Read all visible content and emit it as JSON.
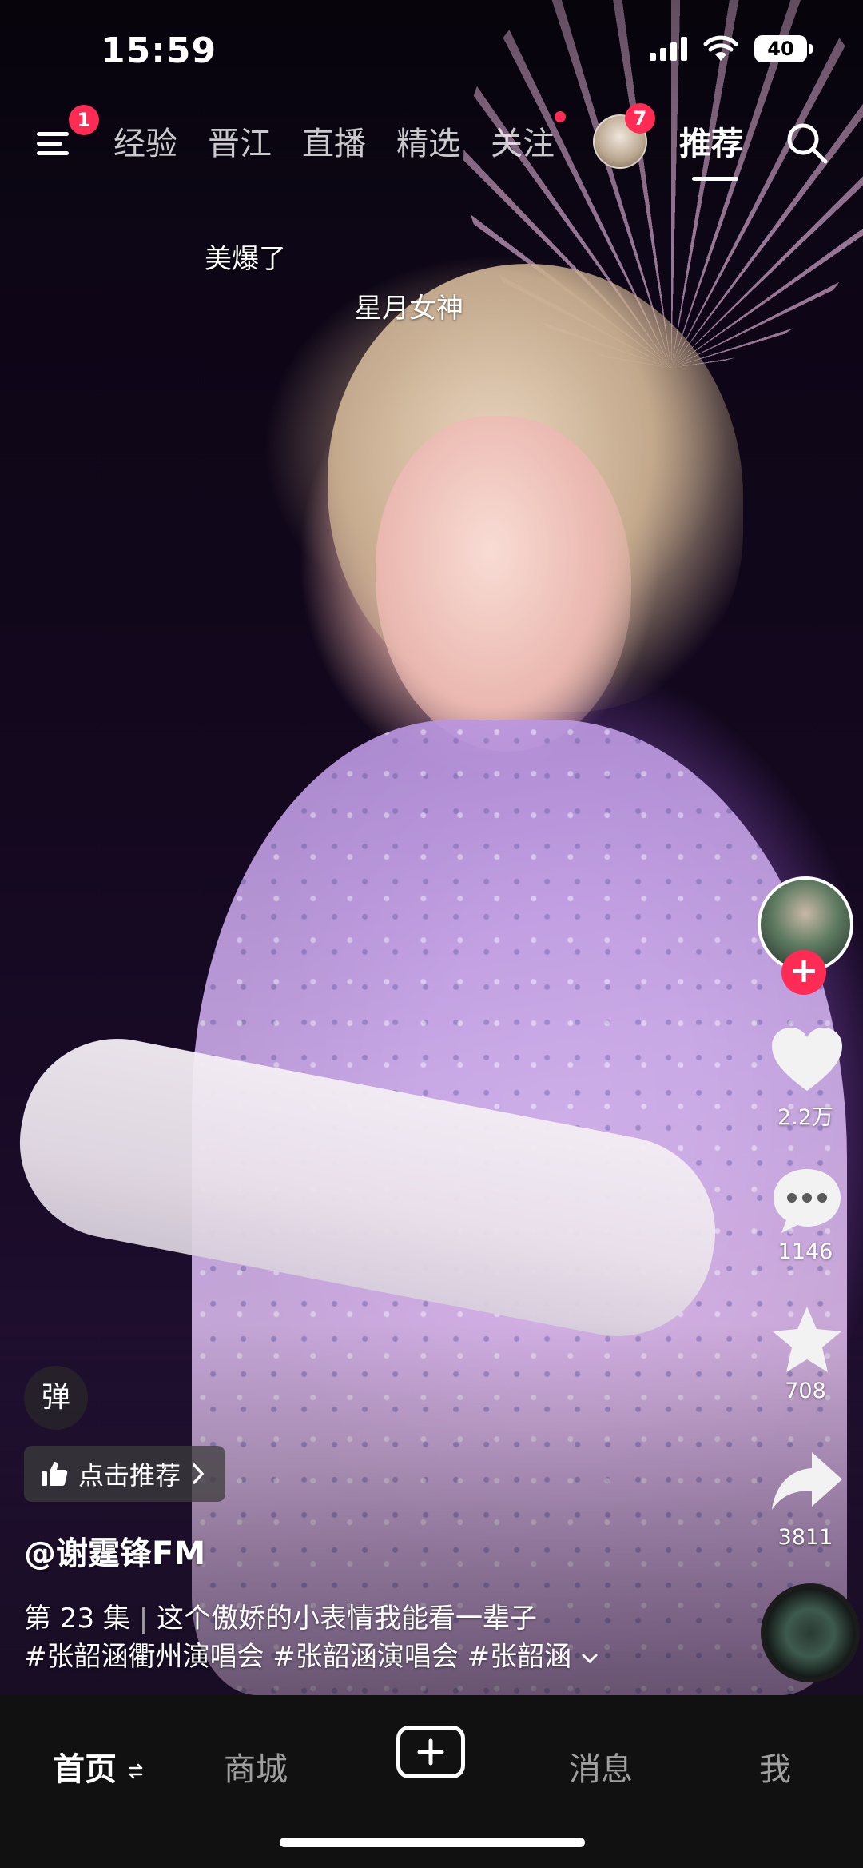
{
  "status_bar": {
    "time": "15:59",
    "battery": "40"
  },
  "top_nav": {
    "menu_badge": "1",
    "tabs": [
      "经验",
      "晋江",
      "直播",
      "精选",
      "关注"
    ],
    "avatar_badge": "7",
    "active_tab": "推荐"
  },
  "danmaku": [
    "美爆了",
    "星月女神"
  ],
  "actions": {
    "likes": "2.2万",
    "comments": "1146",
    "favorites": "708",
    "shares": "3811"
  },
  "video_info": {
    "danmaku_toggle": "弹",
    "recommend_label": "点击推荐",
    "author": "@谢霆锋FM",
    "episode": "第 23 集",
    "caption": "这个傲娇的小表情我能看一辈子",
    "hashtags": "#张韶涵衢州演唱会 #张韶涵演唱会 #张韶涵"
  },
  "bottom_tabs": {
    "home": "首页",
    "mall": "商城",
    "messages": "消息",
    "me": "我"
  },
  "colors": {
    "accent": "#fe2c55",
    "tabbar_bg": "#111111"
  }
}
